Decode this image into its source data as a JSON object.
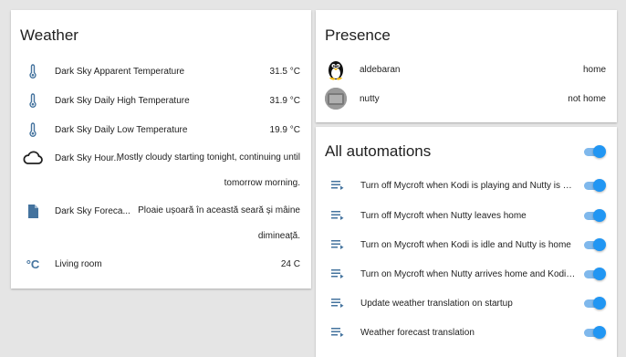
{
  "weather": {
    "title": "Weather",
    "rows": [
      {
        "icon": "thermometer-icon",
        "name": "Dark Sky Apparent Temperature",
        "value": "31.5 °C"
      },
      {
        "icon": "thermometer-icon",
        "name": "Dark Sky Daily High Temperature",
        "value": "31.9 °C"
      },
      {
        "icon": "thermometer-icon",
        "name": "Dark Sky Daily Low Temperature",
        "value": "19.9 °C"
      },
      {
        "icon": "cloud-icon",
        "name": "Dark Sky Hour...",
        "value_line1": "Mostly cloudy starting tonight, continuing until",
        "value_line2": "tomorrow morning."
      },
      {
        "icon": "document-icon",
        "name": "Dark Sky Foreca...",
        "value_line1": "Ploaie ușoară în această seară și mâine",
        "value_line2": "dimineață."
      },
      {
        "icon": "celsius-icon",
        "icon_text": "°C",
        "name": "Living room",
        "value": "24 C"
      }
    ]
  },
  "presence": {
    "title": "Presence",
    "rows": [
      {
        "icon": "tux-avatar-icon",
        "name": "aldebaran",
        "value": "home"
      },
      {
        "icon": "device-avatar-icon",
        "name": "nutty",
        "value": "not home"
      }
    ]
  },
  "automations": {
    "title": "All automations",
    "master_toggle_on": true,
    "rows": [
      {
        "icon": "automation-list-icon",
        "name": "Turn off Mycroft when Kodi is playing and Nutty is home",
        "on": true
      },
      {
        "icon": "automation-list-icon",
        "name": "Turn off Mycroft when Nutty leaves home",
        "on": true
      },
      {
        "icon": "automation-list-icon",
        "name": "Turn on Mycroft when Kodi is idle and Nutty is home",
        "on": true
      },
      {
        "icon": "automation-list-icon",
        "name": "Turn on Mycroft when Nutty arrives home and Kodi is i...",
        "on": true
      },
      {
        "icon": "automation-list-icon",
        "name": "Update weather translation on startup",
        "on": true
      },
      {
        "icon": "automation-list-icon",
        "name": "Weather forecast translation",
        "on": true
      }
    ]
  },
  "colors": {
    "icon": "#44739e",
    "toggle_on": "#2196f3",
    "background": "#e5e5e5"
  }
}
